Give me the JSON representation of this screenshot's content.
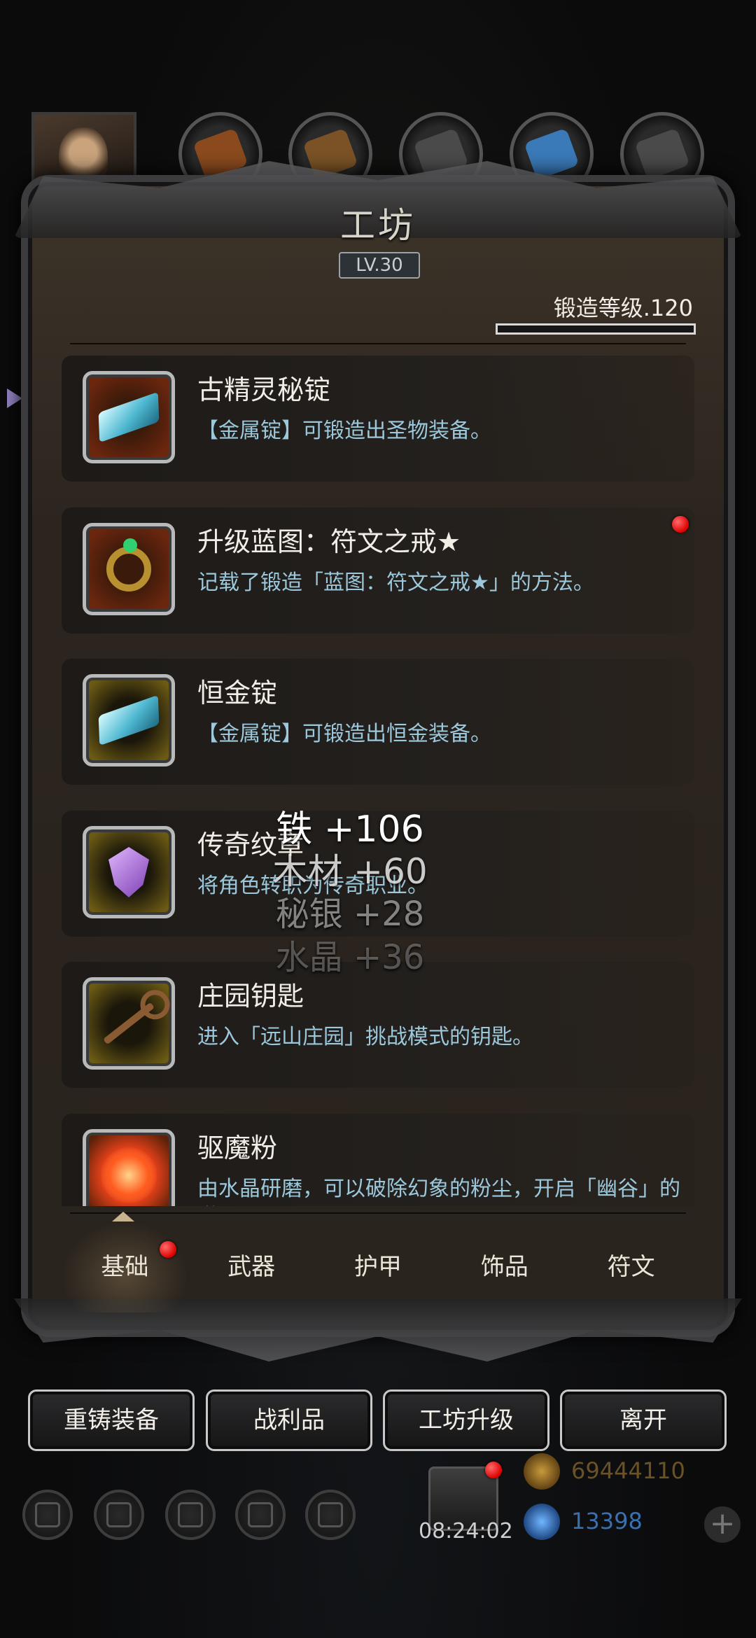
{
  "header": {
    "title": "工坊",
    "level": "LV.30",
    "forge_level_label": "锻造等级.120"
  },
  "top_tabs": [
    {
      "icon": "character-portrait-icon"
    },
    {
      "icon": "iron-material-icon",
      "color": "#8a4a1e"
    },
    {
      "icon": "wood-material-icon",
      "color": "#7a5226"
    },
    {
      "icon": "mithril-material-icon",
      "color": "#4a4a4a"
    },
    {
      "icon": "crystal-material-icon",
      "color": "#3a7ab8"
    },
    {
      "icon": "stone-material-icon",
      "color": "#4a4a4a"
    }
  ],
  "items": [
    {
      "name": "古精灵秘锭",
      "desc": "【金属锭】可锻造出圣物装备。",
      "frame": "red",
      "icon": "ingot-icon",
      "new": false
    },
    {
      "name": "升级蓝图：符文之戒★",
      "desc": "记载了锻造「蓝图：符文之戒★」的方法。",
      "frame": "red",
      "icon": "ring-icon",
      "new": true
    },
    {
      "name": "恒金锭",
      "desc": "【金属锭】可锻造出恒金装备。",
      "frame": "gold",
      "icon": "ingot-icon",
      "new": false
    },
    {
      "name": "传奇纹章",
      "desc": "将角色转职为传奇职业。",
      "frame": "gold",
      "icon": "emblem-icon",
      "new": false
    },
    {
      "name": "庄园钥匙",
      "desc": "进入「远山庄园」挑战模式的钥匙。",
      "frame": "gold",
      "icon": "key-icon",
      "new": false
    },
    {
      "name": "驱魔粉",
      "desc": "由水晶研磨，可以破除幻象的粉尘，开启「幽谷」的道具。",
      "frame": "orange",
      "icon": "powder-icon",
      "new": false
    }
  ],
  "gains": [
    "铁 +106",
    "木材 +60",
    "秘银 +28",
    "水晶 +36"
  ],
  "category_tabs": [
    "基础",
    "武器",
    "护甲",
    "饰品",
    "符文"
  ],
  "active_category": 0,
  "actions": [
    "重铸装备",
    "战利品",
    "工坊升级",
    "离开"
  ],
  "hud": {
    "time": "08:24:02",
    "gold": "69444110",
    "gems": "13398",
    "plus": "+"
  },
  "colors": {
    "gold_text": "#6b5224",
    "gem_text": "#3a6fb0",
    "desc_text": "#9cc8dc"
  }
}
